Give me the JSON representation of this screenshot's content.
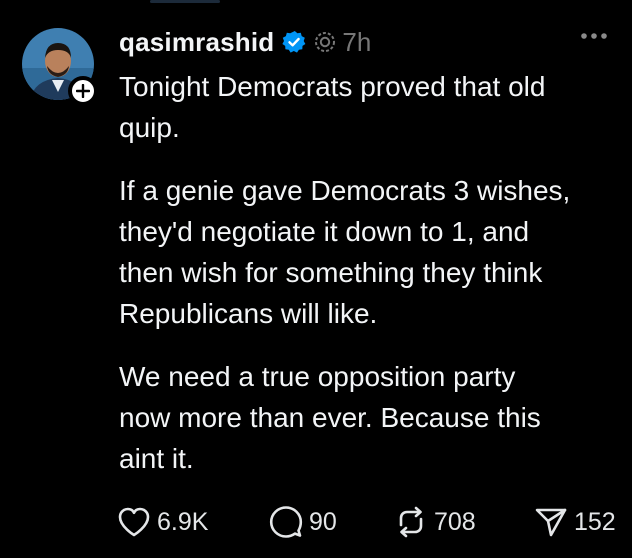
{
  "post": {
    "username": "qasimrashid",
    "timestamp": "7h",
    "paragraphs": [
      "Tonight Democrats proved that old\nquip.",
      "If a genie gave Democrats 3 wishes,\nthey'd negotiate it down to 1, and\nthen wish for something they think\nRepublicans will like.",
      "We need a true opposition party\nnow more than ever. Because this\naint it."
    ]
  },
  "actions": {
    "likes": "6.9K",
    "replies": "90",
    "reposts": "708",
    "shares": "152"
  },
  "icons": {
    "verified": "verified-badge-icon",
    "thread": "threads-icon",
    "more": "more-icon",
    "follow": "plus-icon",
    "like": "heart-icon",
    "reply": "comment-icon",
    "repost": "repost-icon",
    "share": "send-icon"
  },
  "colors": {
    "background": "#000000",
    "text": "#f3f5f7",
    "muted": "#777777",
    "verified": "#0095f6"
  }
}
